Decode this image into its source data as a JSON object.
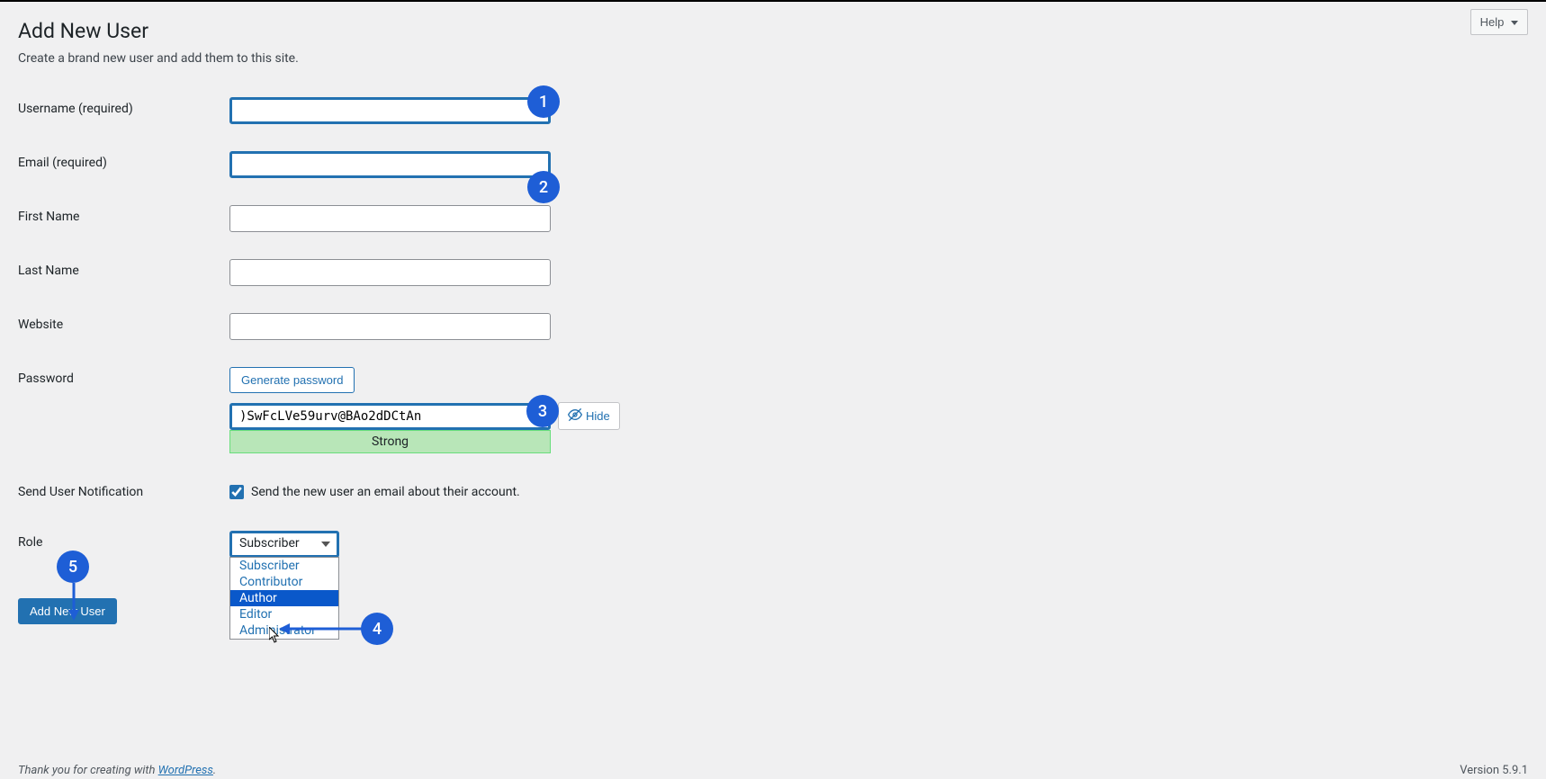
{
  "page": {
    "title": "Add New User",
    "description": "Create a brand new user and add them to this site.",
    "help_label": "Help"
  },
  "form": {
    "username": {
      "label": "Username (required)",
      "value": ""
    },
    "email": {
      "label": "Email (required)",
      "value": ""
    },
    "first_name": {
      "label": "First Name",
      "value": ""
    },
    "last_name": {
      "label": "Last Name",
      "value": ""
    },
    "website": {
      "label": "Website",
      "value": ""
    },
    "password": {
      "label": "Password",
      "generate_label": "Generate password",
      "value": ")SwFcLVe59urv@BAo2dDCtAn",
      "hide_label": "Hide",
      "strength_label": "Strong"
    },
    "notification": {
      "label": "Send User Notification",
      "checkbox_label": "Send the new user an email about their account.",
      "checked": true
    },
    "role": {
      "label": "Role",
      "selected": "Subscriber",
      "options": [
        "Subscriber",
        "Contributor",
        "Author",
        "Editor",
        "Administrator"
      ],
      "hover_index": 2
    },
    "submit_label": "Add New User"
  },
  "footer": {
    "thanks_prefix": "Thank you for creating with ",
    "link_text": "WordPress",
    "suffix": ".",
    "version": "Version 5.9.1"
  },
  "annotations": {
    "b1": "1",
    "b2": "2",
    "b3": "3",
    "b4": "4",
    "b5": "5"
  }
}
